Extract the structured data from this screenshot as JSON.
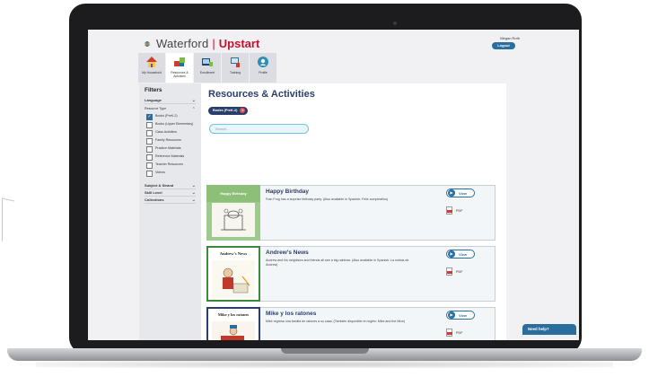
{
  "app": {
    "brand_word": "Waterford",
    "brand_sep": "|",
    "brand_product": "Upstart",
    "user_name": "Megan Roth",
    "logout_label": "Logout",
    "accent": "#2a6e9e",
    "brand_red": "#c8102e"
  },
  "nav": [
    {
      "label": "My Household",
      "icon": "house-icon"
    },
    {
      "label": "Resources & Activities",
      "icon": "puzzle-icon"
    },
    {
      "label": "Enrollment",
      "icon": "enrollment-icon"
    },
    {
      "label": "Training",
      "icon": "training-icon"
    },
    {
      "label": "Profile",
      "icon": "profile-icon"
    }
  ],
  "sidebar": {
    "title": "Filters",
    "language_label": "Language",
    "resource_type_label": "Resource Type",
    "resource_types": [
      {
        "label": "Books (PreK-2)",
        "checked": true
      },
      {
        "label": "Books (Upper Elementary)",
        "checked": false
      },
      {
        "label": "Class Activities",
        "checked": false
      },
      {
        "label": "Family Resources",
        "checked": false
      },
      {
        "label": "Practice Materials",
        "checked": false
      },
      {
        "label": "Reference Materials",
        "checked": false
      },
      {
        "label": "Teacher Resources",
        "checked": false
      },
      {
        "label": "Videos",
        "checked": false
      }
    ],
    "groups": [
      {
        "label": "Subject & Strand"
      },
      {
        "label": "Skill Level"
      },
      {
        "label": "Collections"
      }
    ]
  },
  "main": {
    "title": "Resources & Activities",
    "active_filter_chip": "Books (PreK-2)",
    "search_placeholder": "Search...",
    "view_label": "View",
    "pdf_label": "PDF",
    "cards": [
      {
        "title": "Happy Birthday",
        "description": "Fran Frog has a surprise birthday party. (Also available in Spanish: Feliz cumpleaños)",
        "thumb_text": "Happy Birthday"
      },
      {
        "title": "Andrew's News",
        "description": "Andrew and his neighbors and friends all see a big rainbow. (Also available in Spanish: La noticia de Andrew)",
        "thumb_text": "Andrew's News"
      },
      {
        "title": "Mike y los ratones",
        "description": "Mike regresa una familia de ratones a su casa. (También disponible en inglés: Mike and the Mice)",
        "thumb_text": "Mike y los ratones"
      }
    ]
  },
  "help_label": "Need help?"
}
